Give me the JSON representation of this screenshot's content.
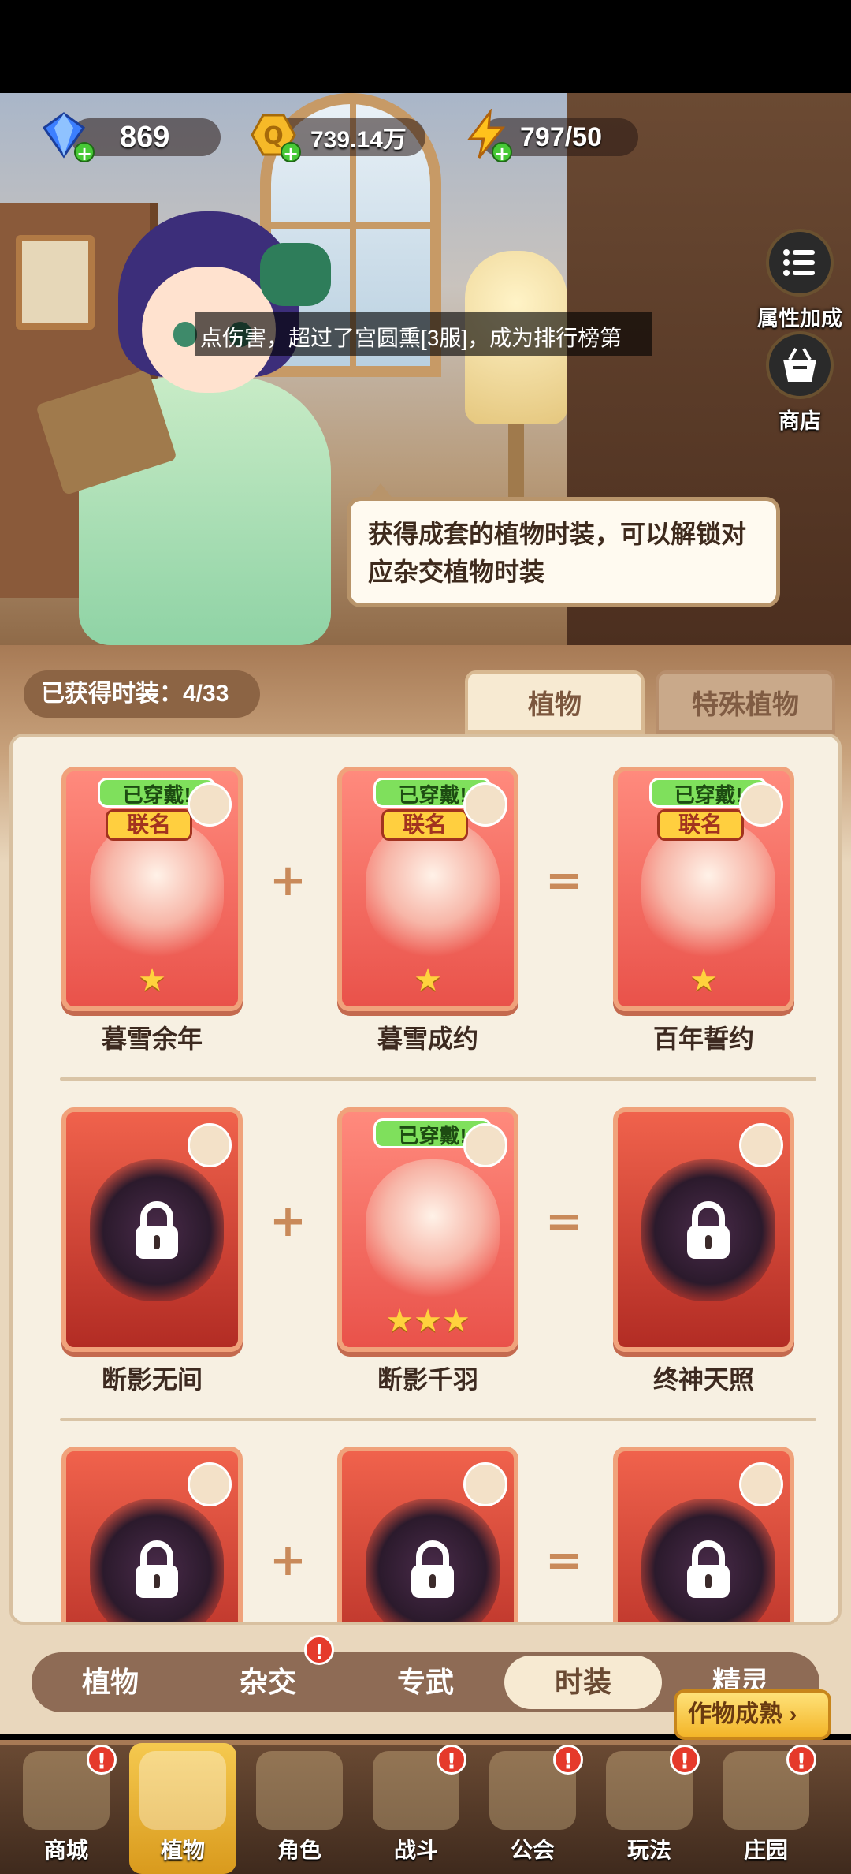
{
  "resources": {
    "gems": "869",
    "coins": "739.14万",
    "energy": "797/50"
  },
  "marquee": "点伤害，超过了宫圆熏[3服]，成为排行榜第",
  "side_buttons": {
    "attributes": "属性加成",
    "shop": "商店"
  },
  "speech": "获得成套的植物时装，可以解锁对应杂交植物时装",
  "collection": {
    "obtained_label": "已获得时装：4/33"
  },
  "category_tabs": [
    "植物",
    "特殊植物"
  ],
  "rows": [
    {
      "cards": [
        {
          "name": "暮雪余年",
          "equipped": "已穿戴!",
          "tag": "联名",
          "stars": "★",
          "locked": false
        },
        {
          "name": "暮雪成约",
          "equipped": "已穿戴!",
          "tag": "联名",
          "stars": "★",
          "locked": false
        },
        {
          "name": "百年誓约",
          "equipped": "已穿戴!",
          "tag": "联名",
          "stars": "★",
          "locked": false
        }
      ]
    },
    {
      "cards": [
        {
          "name": "断影无间",
          "equipped": "",
          "tag": "",
          "stars": "",
          "locked": true
        },
        {
          "name": "断影千羽",
          "equipped": "已穿戴!",
          "tag": "",
          "stars": "★★★",
          "locked": false
        },
        {
          "name": "终神天照",
          "equipped": "",
          "tag": "",
          "stars": "",
          "locked": true
        }
      ]
    },
    {
      "cards": [
        {
          "name": "",
          "equipped": "",
          "tag": "",
          "stars": "",
          "locked": true
        },
        {
          "name": "",
          "equipped": "",
          "tag": "",
          "stars": "",
          "locked": true
        },
        {
          "name": "",
          "equipped": "",
          "tag": "",
          "stars": "",
          "locked": true
        }
      ]
    }
  ],
  "operators": {
    "plus": "+",
    "equals": "="
  },
  "subtabs": [
    "植物",
    "杂交",
    "专武",
    "时装",
    "精灵"
  ],
  "subtab_active": "时装",
  "harvest_button": "作物成熟 ›",
  "alert_mark": "!",
  "bottom_nav": [
    "商城",
    "植物",
    "角色",
    "战斗",
    "公会",
    "玩法",
    "庄园"
  ],
  "bottom_nav_active": "植物",
  "colors": {
    "accent": "#f3b528",
    "card_red": "#e9524a",
    "alert_red": "#e53a2b",
    "equipped_green": "#7fe05c"
  }
}
